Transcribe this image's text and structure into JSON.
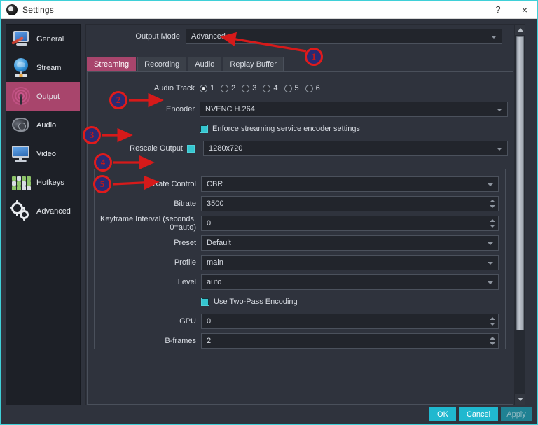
{
  "window": {
    "title": "Settings",
    "icon": "obs-logo-icon",
    "help_label": "?",
    "close_label": "×",
    "border_color": "#3fd0d8"
  },
  "sidebar": {
    "items": [
      {
        "label": "General",
        "icon": "general-icon",
        "selected": false
      },
      {
        "label": "Stream",
        "icon": "stream-icon",
        "selected": false
      },
      {
        "label": "Output",
        "icon": "output-icon",
        "selected": true
      },
      {
        "label": "Audio",
        "icon": "audio-icon",
        "selected": false
      },
      {
        "label": "Video",
        "icon": "video-icon",
        "selected": false
      },
      {
        "label": "Hotkeys",
        "icon": "hotkeys-icon",
        "selected": false
      },
      {
        "label": "Advanced",
        "icon": "advanced-icon",
        "selected": false
      }
    ],
    "selected_color": "#a8456c"
  },
  "output_mode": {
    "label": "Output Mode",
    "value": "Advanced"
  },
  "tabs": [
    {
      "label": "Streaming",
      "active": true
    },
    {
      "label": "Recording",
      "active": false
    },
    {
      "label": "Audio",
      "active": false
    },
    {
      "label": "Replay Buffer",
      "active": false
    }
  ],
  "streaming": {
    "audio_track": {
      "label": "Audio Track",
      "options": [
        "1",
        "2",
        "3",
        "4",
        "5",
        "6"
      ],
      "selected": "1"
    },
    "encoder": {
      "label": "Encoder",
      "value": "NVENC H.264"
    },
    "enforce": {
      "label": "Enforce streaming service encoder settings",
      "checked": true
    },
    "rescale": {
      "label": "Rescale Output",
      "checked": true,
      "value": "1280x720"
    },
    "rate_control": {
      "label": "Rate Control",
      "value": "CBR"
    },
    "bitrate": {
      "label": "Bitrate",
      "value": "3500"
    },
    "keyframe": {
      "label": "Keyframe Interval (seconds, 0=auto)",
      "value": "0"
    },
    "preset": {
      "label": "Preset",
      "value": "Default"
    },
    "profile": {
      "label": "Profile",
      "value": "main"
    },
    "level": {
      "label": "Level",
      "value": "auto"
    },
    "two_pass": {
      "label": "Use Two-Pass Encoding",
      "checked": true
    },
    "gpu": {
      "label": "GPU",
      "value": "0"
    },
    "bframes": {
      "label": "B-frames",
      "value": "2"
    }
  },
  "footer": {
    "ok": "OK",
    "cancel": "Cancel",
    "apply": "Apply",
    "accent_color": "#20b8cf"
  },
  "annotations": {
    "marker_fill": "#2a2a72",
    "marker_ring": "#e01b1b",
    "markers": [
      {
        "number": "1"
      },
      {
        "number": "2"
      },
      {
        "number": "3"
      },
      {
        "number": "4"
      },
      {
        "number": "5"
      }
    ]
  }
}
